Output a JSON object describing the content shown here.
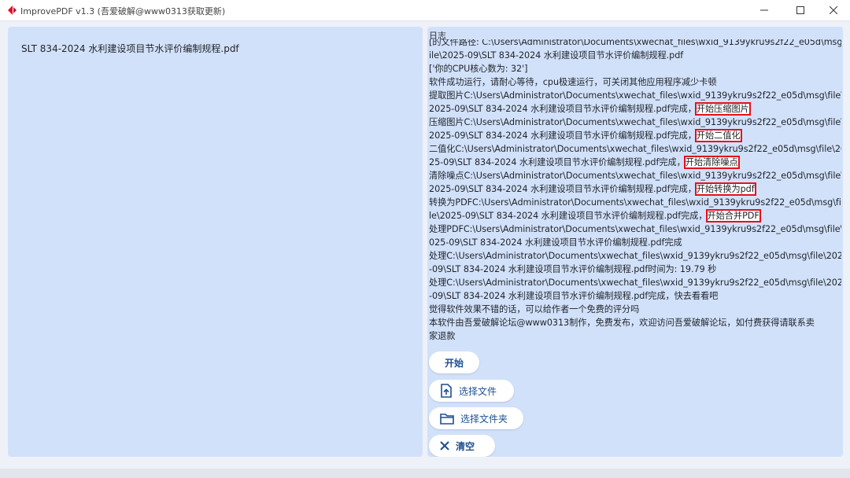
{
  "window": {
    "title": "ImprovePDF v1.3 (吾爱破解@www0313获取更新)",
    "accent": "#e5101a"
  },
  "file_list": {
    "items": [
      "SLT 834-2024 水利建设项目节水评价编制规程.pdf"
    ]
  },
  "log": {
    "title": "日志",
    "lines": [
      {
        "text": "[的文件路径: C:\\Users\\Administrator\\Documents\\xwechat_files\\wxid_9139ykru9s2f22_e05d\\msg\\"
      },
      {
        "text": "ile\\2025-09\\SLT 834-2024 水利建设项目节水评价编制规程.pdf"
      },
      {
        "text": "['你的CPU核心数为: 32']"
      },
      {
        "text": "软件成功运行，请耐心等待，cpu极速运行，可关闭其他应用程序减少卡顿"
      },
      {
        "text": "提取图片C:\\Users\\Administrator\\Documents\\xwechat_files\\wxid_9139ykru9s2f22_e05d\\msg\\file\\"
      },
      {
        "text": "2025-09\\SLT 834-2024 水利建设项目节水评价编制规程.pdf完成，",
        "highlight": "开始压缩图片"
      },
      {
        "text": "压缩图片C:\\Users\\Administrator\\Documents\\xwechat_files\\wxid_9139ykru9s2f22_e05d\\msg\\file\\"
      },
      {
        "text": "2025-09\\SLT 834-2024 水利建设项目节水评价编制规程.pdf完成，",
        "highlight": "开始二值化"
      },
      {
        "text": "二值化C:\\Users\\Administrator\\Documents\\xwechat_files\\wxid_9139ykru9s2f22_e05d\\msg\\file\\20"
      },
      {
        "text": "25-09\\SLT 834-2024 水利建设项目节水评价编制规程.pdf完成，",
        "highlight": "开始清除噪点"
      },
      {
        "text": "清除噪点C:\\Users\\Administrator\\Documents\\xwechat_files\\wxid_9139ykru9s2f22_e05d\\msg\\file\\"
      },
      {
        "text": "2025-09\\SLT 834-2024 水利建设项目节水评价编制规程.pdf完成，",
        "highlight": "开始转换为pdf"
      },
      {
        "text": "转换为PDFC:\\Users\\Administrator\\Documents\\xwechat_files\\wxid_9139ykru9s2f22_e05d\\msg\\fi"
      },
      {
        "text": "le\\2025-09\\SLT 834-2024 水利建设项目节水评价编制规程.pdf完成，",
        "highlight": "开始合并PDF"
      },
      {
        "text": "处理PDFC:\\Users\\Administrator\\Documents\\xwechat_files\\wxid_9139ykru9s2f22_e05d\\msg\\file\\2"
      },
      {
        "text": "025-09\\SLT 834-2024 水利建设项目节水评价编制规程.pdf完成"
      },
      {
        "text": "处理C:\\Users\\Administrator\\Documents\\xwechat_files\\wxid_9139ykru9s2f22_e05d\\msg\\file\\2025"
      },
      {
        "text": "-09\\SLT 834-2024 水利建设项目节水评价编制规程.pdf时间为: 19.79 秒"
      },
      {
        "text": "处理C:\\Users\\Administrator\\Documents\\xwechat_files\\wxid_9139ykru9s2f22_e05d\\msg\\file\\2025"
      },
      {
        "text": "-09\\SLT 834-2024 水利建设项目节水评价编制规程.pdf完成，快去看看吧"
      },
      {
        "text": "觉得软件效果不错的话，可以给作者一个免费的评分吗"
      },
      {
        "text": "本软件由吾爱破解论坛@www0313制作，免费发布，欢迎访问吾爱破解论坛，如付费获得请联系卖"
      },
      {
        "text": "家退款"
      }
    ]
  },
  "buttons": {
    "start": "开始",
    "select_file": "选择文件",
    "select_folder": "选择文件夹",
    "clear": "清空"
  }
}
